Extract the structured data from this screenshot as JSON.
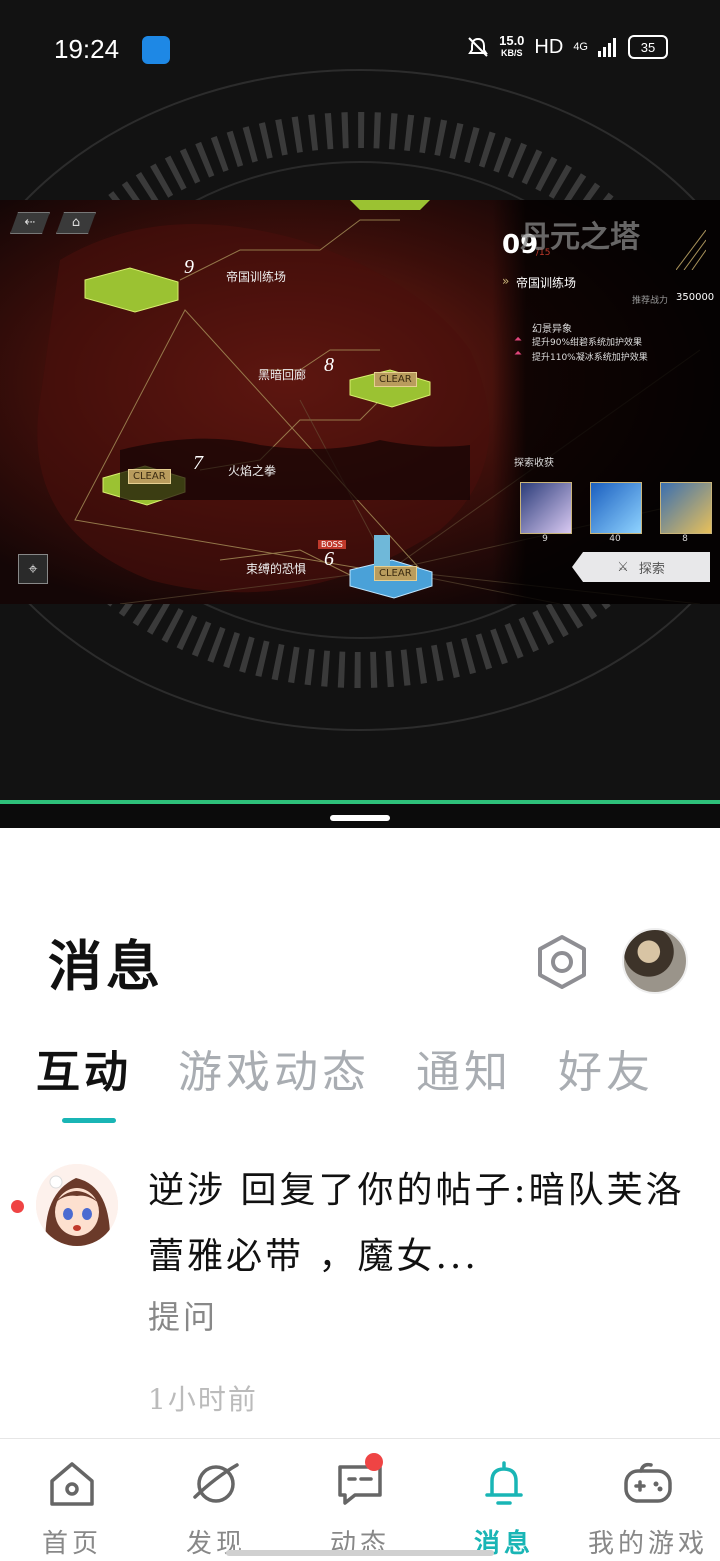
{
  "status_bar": {
    "time": "19:24",
    "speed_value": "15.0",
    "speed_unit": "KB/S",
    "hd": "HD",
    "network": "4G",
    "battery": "35"
  },
  "game": {
    "stage_current": "09",
    "stage_total": "/15",
    "tower_title": "丹元之塔",
    "stage_name": "帝国训练场",
    "power_label": "推荐战力",
    "power_value": "350000",
    "phenomenon_title": "幻景异象",
    "effects": [
      "提升90%绀碧系统加护效果",
      "提升110%凝冰系统加护效果"
    ],
    "rewards_title": "探索收获",
    "rewards": [
      {
        "icon": "snowflake-crystal-icon",
        "count": "9"
      },
      {
        "icon": "blue-crystal-icon",
        "count": "40"
      },
      {
        "icon": "fruit-basket-icon",
        "count": "8"
      }
    ],
    "explore_label": "探索",
    "stages": [
      {
        "num": "9",
        "name": "帝国训练场"
      },
      {
        "num": "8",
        "name": "黑暗回廊",
        "tag": "CLEAR"
      },
      {
        "num": "7",
        "name": "火焰之拳",
        "tag": "CLEAR"
      },
      {
        "num": "6",
        "name": "束缚的恐惧",
        "tag": "CLEAR",
        "boss": "BOSS"
      }
    ]
  },
  "app": {
    "title": "消息",
    "tabs": [
      {
        "label": "互动",
        "active": true
      },
      {
        "label": "游戏动态",
        "active": false
      },
      {
        "label": "通知",
        "active": false
      },
      {
        "label": "好友",
        "active": false
      }
    ],
    "message": {
      "text": "逆涉 回复了你的帖子:暗队芙洛蕾雅必带 ，魔女...",
      "tag": "提问",
      "time": "1小时前"
    },
    "bottom_nav": [
      {
        "label": "首页",
        "icon": "home-icon"
      },
      {
        "label": "发现",
        "icon": "planet-icon"
      },
      {
        "label": "动态",
        "icon": "chat-icon"
      },
      {
        "label": "消息",
        "icon": "bell-icon",
        "active": true
      },
      {
        "label": "我的游戏",
        "icon": "gamepad-icon"
      }
    ],
    "accent_color": "#19b5b5"
  }
}
